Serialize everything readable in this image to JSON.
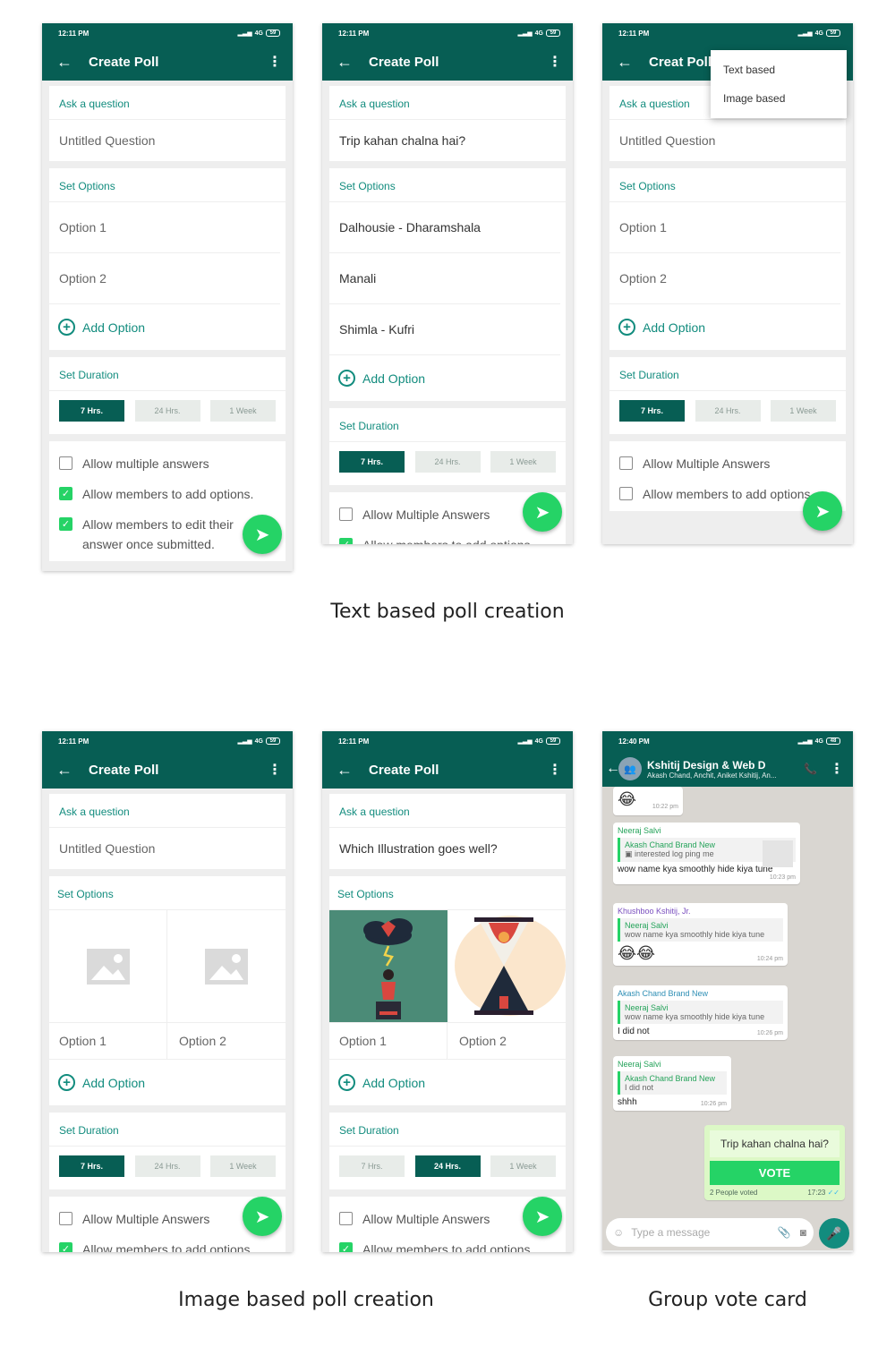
{
  "status": {
    "time": "12:11 PM",
    "network": "4G",
    "battery": "59"
  },
  "chat_status": {
    "time": "12:40 PM",
    "network": "4G",
    "battery": "48"
  },
  "app": {
    "title": "Create Poll",
    "title_truncated": "Creat Poll"
  },
  "labels": {
    "ask": "Ask a question",
    "set_options": "Set Options",
    "set_duration": "Set Duration",
    "add_option": "Add Option",
    "untitled": "Untitled Question",
    "option1": "Option 1",
    "option2": "Option 2"
  },
  "durations": [
    "7 Hrs.",
    "24 Hrs.",
    "1 Week"
  ],
  "screen1": {
    "checks": [
      "Allow multiple answers",
      "Allow members to add options.",
      "Allow members to edit their answer once submitted."
    ]
  },
  "screen2": {
    "question": "Trip kahan chalna hai?",
    "options": [
      "Dalhousie - Dharamshala",
      "Manali",
      "Shimla - Kufri"
    ],
    "checks": [
      "Allow Multiple Answers",
      "Allow members to add options"
    ]
  },
  "screen3": {
    "menu": [
      "Text based",
      "Image based"
    ],
    "checks": [
      "Allow Multiple Answers",
      "Allow members to add options"
    ]
  },
  "screen5": {
    "question": "Which Illustration goes well?"
  },
  "captions": {
    "text_based": "Text based poll creation",
    "image_based": "Image based poll creation",
    "group_vote": "Group vote card"
  },
  "chat": {
    "title": "Kshitij Design & Web D",
    "subtitle": "Akash Chand, Anchit, Aniket Kshitij, An...",
    "m1_time": "10:22 pm",
    "m2": {
      "sender": "Neeraj Salvi",
      "quote_name": "Akash Chand Brand New",
      "quote_text": "interested log ping me",
      "text": "wow name kya smoothly hide kiya tune",
      "time": "10:23 pm"
    },
    "m3": {
      "sender": "Khushboo Kshitij, Jr.",
      "quote_name": "Neeraj Salvi",
      "quote_text": "wow name kya smoothly hide kiya tune",
      "time": "10:24 pm"
    },
    "m4": {
      "sender": "Akash Chand Brand New",
      "quote_name": "Neeraj Salvi",
      "quote_text": "wow name kya smoothly hide kiya tune",
      "text": "I did not",
      "time": "10:26 pm"
    },
    "m5": {
      "sender": "Neeraj Salvi",
      "quote_name": "Akash Chand Brand New",
      "quote_text": "I did not",
      "text": "shhh",
      "time": "10:26 pm"
    },
    "poll": {
      "question": "Trip kahan chalna hai?",
      "vote": "VOTE",
      "voted": "2 People voted",
      "time": "17:23"
    },
    "input_placeholder": "Type a message"
  },
  "colors": {
    "primary": "#075e54",
    "accent": "#128c7e",
    "green": "#25d366",
    "chat_bg": "#d9d6d1"
  }
}
